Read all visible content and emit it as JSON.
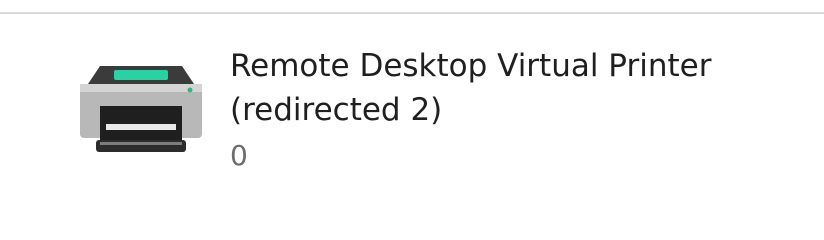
{
  "printer": {
    "name": "Remote Desktop Virtual Printer (redirected 2)",
    "status": "0",
    "icon": "printer-icon",
    "accent_color": "#27d3a2"
  }
}
